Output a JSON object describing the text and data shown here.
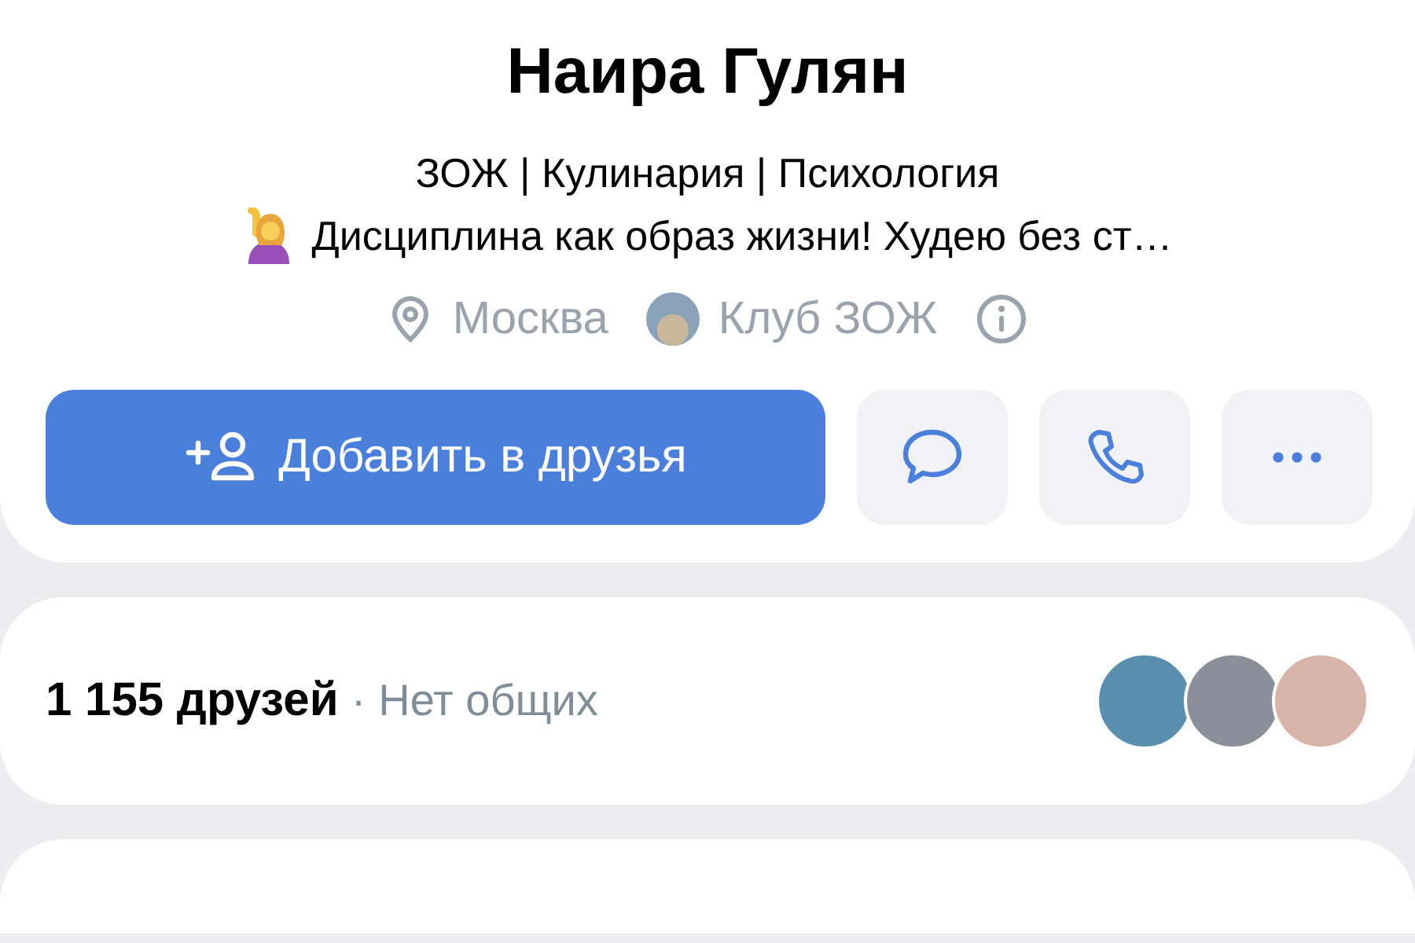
{
  "profile": {
    "name": "Наира Гулян",
    "bio_lines": [
      "ЗОЖ | Кулинария | Психология",
      "Дисциплина как образ жизни! Худею без ст…"
    ],
    "meta": [
      {
        "kind": "location",
        "label": "Москва"
      },
      {
        "kind": "community",
        "label": "Клуб ЗОЖ"
      },
      {
        "kind": "info"
      }
    ],
    "actions": [
      {
        "kind": "primary",
        "label": "Добавить в друзья"
      },
      {
        "kind": "message"
      },
      {
        "kind": "call"
      },
      {
        "kind": "more"
      }
    ]
  },
  "friends": {
    "count": "1 155 друзей",
    "separator": "·",
    "mutual": "Нет общих",
    "avatars": [
      {
        "kind": "photo"
      },
      {
        "kind": "photo"
      },
      {
        "kind": "photo"
      }
    ]
  }
}
